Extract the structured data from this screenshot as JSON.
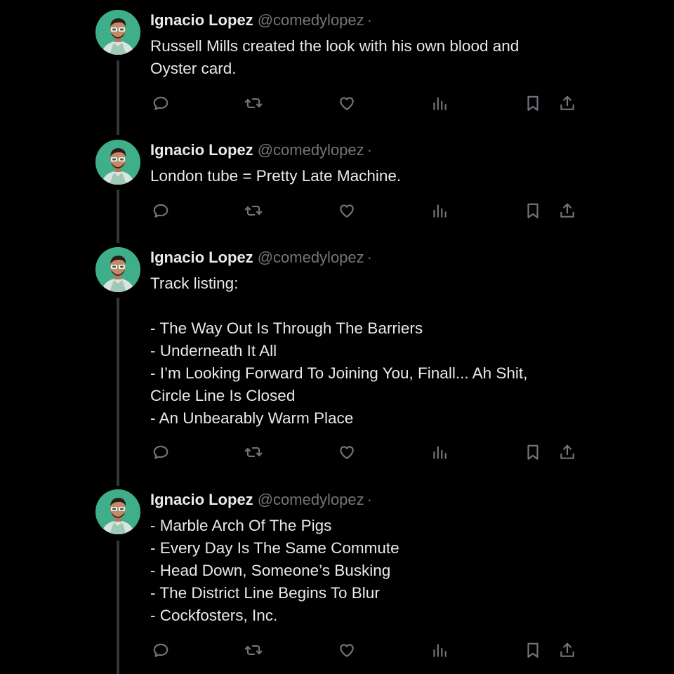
{
  "tweets": [
    {
      "name": "Ignacio Lopez",
      "handle": "@comedylopez",
      "separator": "·",
      "lines": [
        "Russell Mills created the look with his own blood and",
        "Oyster card."
      ]
    },
    {
      "name": "Ignacio Lopez",
      "handle": "@comedylopez",
      "separator": "·",
      "lines": [
        "London tube = Pretty Late Machine."
      ]
    },
    {
      "name": "Ignacio Lopez",
      "handle": "@comedylopez",
      "separator": "·",
      "lines": [
        "Track listing:",
        "",
        "- The Way Out Is Through The Barriers",
        "- Underneath It All",
        "- I’m Looking Forward To Joining You, Finall... Ah Shit,",
        "Circle Line Is Closed",
        "- An Unbearably Warm Place"
      ]
    },
    {
      "name": "Ignacio Lopez",
      "handle": "@comedylopez",
      "separator": "·",
      "lines": [
        "- Marble Arch Of The Pigs",
        "- Every Day Is The Same Commute",
        "- Head Down, Someone’s Busking",
        "- The District Line Begins To Blur",
        "- Cockfosters, Inc."
      ]
    }
  ],
  "icons": [
    "reply-icon",
    "retweet-icon",
    "like-icon",
    "views-icon",
    "bookmark-icon",
    "share-icon"
  ],
  "colors": {
    "background": "#000000",
    "text": "#e7e9ea",
    "muted": "#71767b",
    "thread_line": "#333639",
    "avatar_bg": "#3fae8a"
  }
}
